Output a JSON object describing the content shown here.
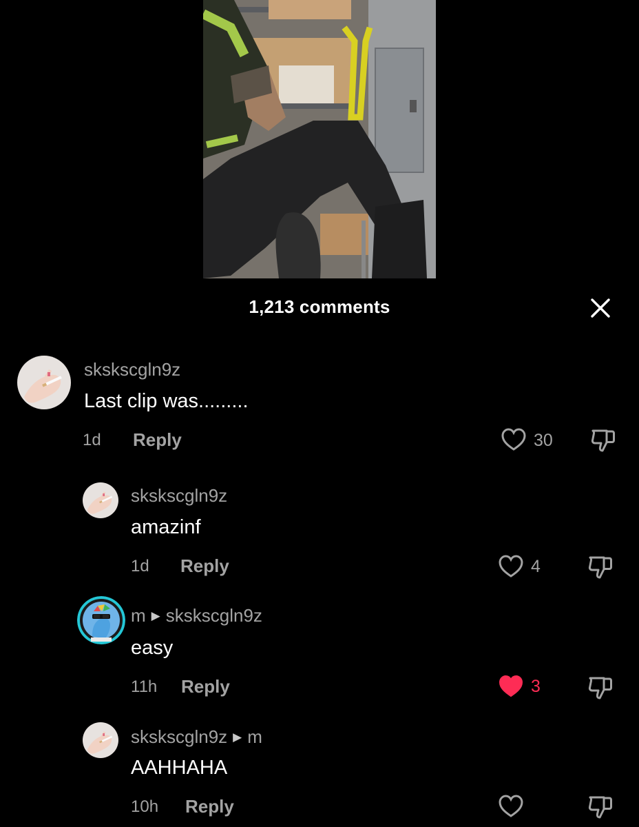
{
  "header": {
    "comment_count": "1,213 comments"
  },
  "colors": {
    "background": "#000000",
    "secondary_text": "#a3a3a3",
    "liked": "#fe2c55",
    "avatar_ring": "#24c7d6"
  },
  "comments": [
    {
      "username": "sksksсgln9z",
      "text": "Last clip was.........",
      "time": "1d",
      "reply_label": "Reply",
      "likes": "30",
      "liked": false,
      "avatar_icon": "smoking-hand-avatar"
    },
    {
      "username": "sksksсgln9z",
      "text": "amazinf",
      "time": "1d",
      "reply_label": "Reply",
      "likes": "4",
      "liked": false,
      "avatar_icon": "smoking-hand-avatar"
    },
    {
      "username": "m",
      "reply_to": "sksksсgln9z",
      "text": "easy",
      "time": "11h",
      "reply_label": "Reply",
      "likes": "3",
      "liked": true,
      "avatar_icon": "cartoon-pony-sunglasses-avatar"
    },
    {
      "username": "sksksсgln9z",
      "reply_to": "m",
      "text": "AAHHAHA",
      "time": "10h",
      "reply_label": "Reply",
      "likes": "",
      "liked": false,
      "avatar_icon": "smoking-hand-avatar"
    }
  ]
}
